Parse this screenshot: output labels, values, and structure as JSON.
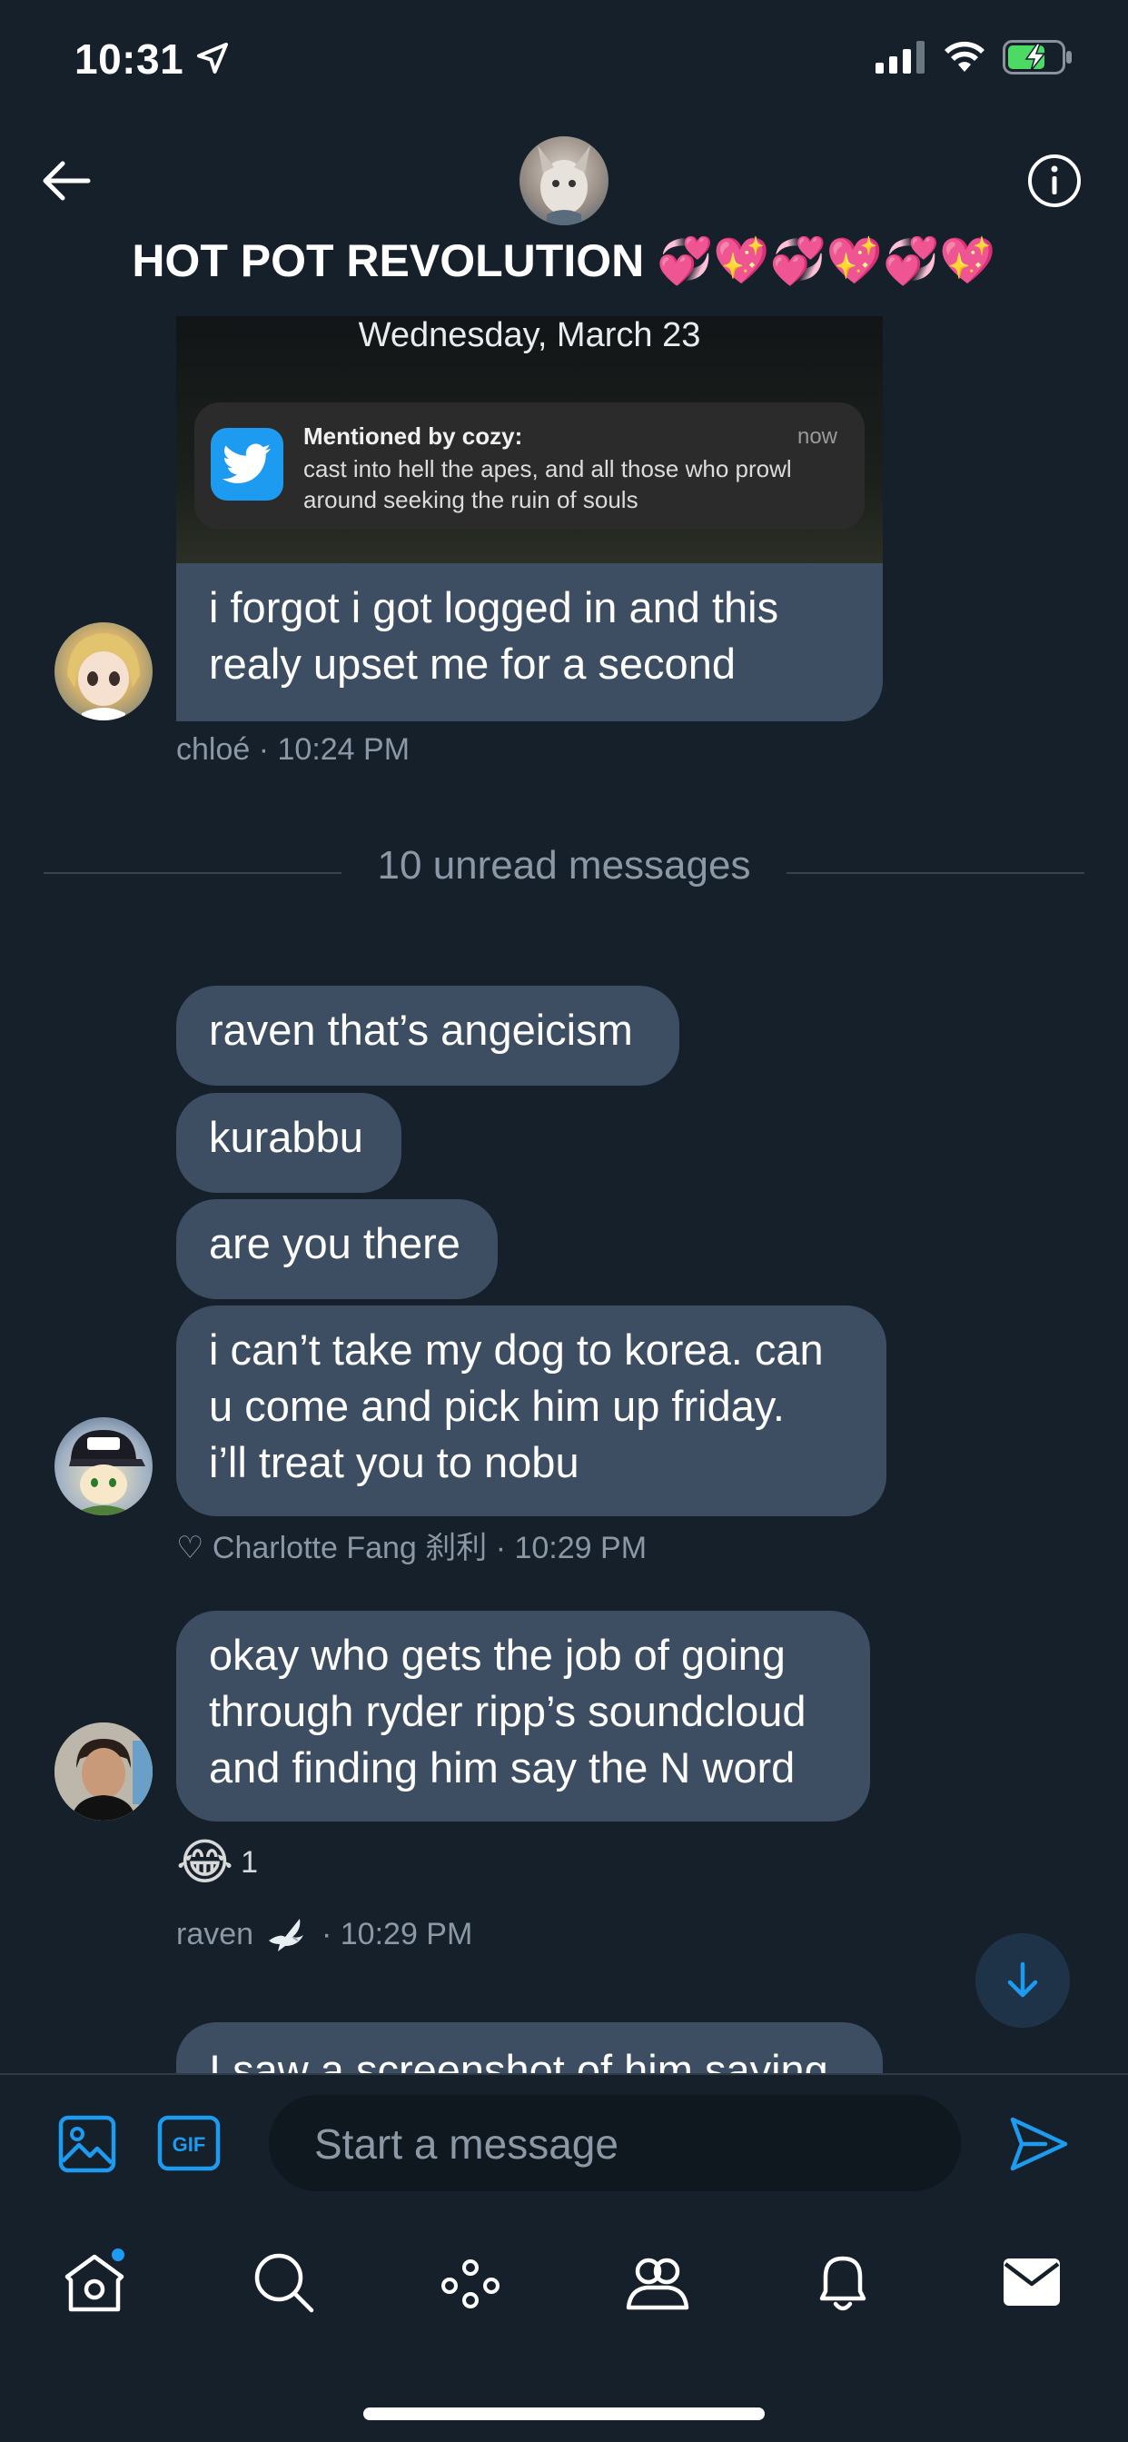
{
  "status": {
    "time": "10:31"
  },
  "header": {
    "title": "HOT POT REVOLUTION 💞💖💞💖💞💖"
  },
  "attachment": {
    "date": "Wednesday, March 23",
    "notification": {
      "title": "Mentioned by cozy:",
      "time": "now",
      "body": "cast into hell the apes, and all those who prowl around seeking the ruin of souls"
    }
  },
  "messages": [
    {
      "text_lines": [
        "i forgot i got logged in and this",
        "realy upset me for a second"
      ],
      "meta": "chloé · 10:24 PM"
    },
    {
      "text": "raven that’s angeicism"
    },
    {
      "text": "kurabbu"
    },
    {
      "text": "are you there"
    },
    {
      "text_lines": [
        "i can’t take my dog to korea. can",
        "u come and pick him up friday.",
        "i’ll treat you to nobu"
      ],
      "meta": "♡ Charlotte Fang 刹利 · 10:29 PM"
    },
    {
      "text_lines": [
        "okay who gets the job of going",
        "through ryder ripp’s soundcloud",
        "and finding him say the N word"
      ],
      "reaction": {
        "emoji": "😂",
        "count": "1"
      },
      "meta_name": "raven",
      "meta_time": "· 10:29 PM"
    },
    {
      "text": "I saw a screenshot of him saying"
    }
  ],
  "divider": {
    "unread": "10 unread messages"
  },
  "composer": {
    "placeholder": "Start a message"
  },
  "nav": [
    "home-icon",
    "search-icon",
    "spaces-icon",
    "communities-icon",
    "notifications-icon",
    "messages-icon"
  ],
  "colors": {
    "background": "#15202b",
    "bubble": "#3d4e63",
    "accent": "#1d9bf0",
    "muted_text": "#8b98a5"
  }
}
